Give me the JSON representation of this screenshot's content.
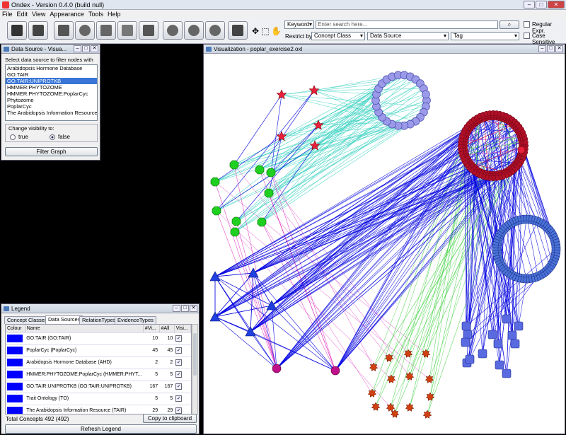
{
  "app": {
    "title": "Ondex - Version 0.4.0 (build null)"
  },
  "menu": [
    "File",
    "Edit",
    "View",
    "Appearance",
    "Tools",
    "Help"
  ],
  "search": {
    "keyword_label": "Keyword",
    "placeholder": "Enter search here...",
    "regular_expr": "Regular Expr.",
    "case_sensitive": "Case Sensitive",
    "restrict_by": "Restrict by:",
    "concept_class": "Concept Class",
    "data_source": "Data Source",
    "tag": "Tag"
  },
  "datasource_panel": {
    "title": "Data Source - Visua...",
    "instruction": "Select data source to filter nodes with",
    "items": [
      "Arabidopsis Hormone Database",
      "GO:TAIR",
      "GO:TAIR:UNIPROTKB",
      "HMMER:PHYTOZOME",
      "HMMER:PHYTOZOME:PoplarCyc",
      "Phytozome",
      "PoplarCyc",
      "The Arabidopsis Information Resource"
    ],
    "selected_index": 2,
    "visibility_legend": "Change visibility to:",
    "opt_true": "true",
    "opt_false": "false",
    "filter_button": "Filter Graph"
  },
  "legend_panel": {
    "title": "Legend",
    "tabs": [
      "Concept Classes",
      "Data Sources",
      "RelationTypes",
      "EvidenceTypes"
    ],
    "active_tab": 1,
    "columns": [
      "Colour",
      "Name",
      "#Vi...",
      "#All",
      "Visi..."
    ],
    "rows": [
      {
        "name": "GO:TAIR (GO:TAIR)",
        "vis": "10",
        "all": "10",
        "color": "#0000ff"
      },
      {
        "name": "PoplarCyc (PoplarCyc)",
        "vis": "45",
        "all": "45",
        "color": "#0000ff"
      },
      {
        "name": "Arabidopsis Hormone Database (AHD)",
        "vis": "2",
        "all": "2",
        "color": "#0000ff"
      },
      {
        "name": "HMMER:PHYTOZOME:PoplarCyc (HMMER:PHYT...",
        "vis": "5",
        "all": "5",
        "color": "#0000ff"
      },
      {
        "name": "GO:TAIR:UNIPROTKB (GO:TAIR:UNIPROTKB)",
        "vis": "167",
        "all": "167",
        "color": "#0000ff"
      },
      {
        "name": "Trait Ontology (TO)",
        "vis": "5",
        "all": "5",
        "color": "#0000ff"
      },
      {
        "name": "The Arabidopsis Information Resource (TAIR)",
        "vis": "29",
        "all": "29",
        "color": "#0000ff"
      }
    ],
    "total": "Total Concepts 492 (492)",
    "copy_button": "Copy to clipboard",
    "refresh_button": "Refresh Legend"
  },
  "viz_panel": {
    "title": "Visualization - poplar_exercise2.oxl"
  },
  "colors": {
    "edge_blue": "#0000e0",
    "edge_cyan": "#3ad1c1",
    "edge_magenta": "#e030c0",
    "edge_green": "#40d040",
    "node_lavender": "#9a9ae8",
    "node_red": "#e8203c",
    "node_green": "#20d020",
    "node_blue": "#2040e0",
    "node_orange": "#d04010",
    "node_purple": "#c0108a"
  }
}
